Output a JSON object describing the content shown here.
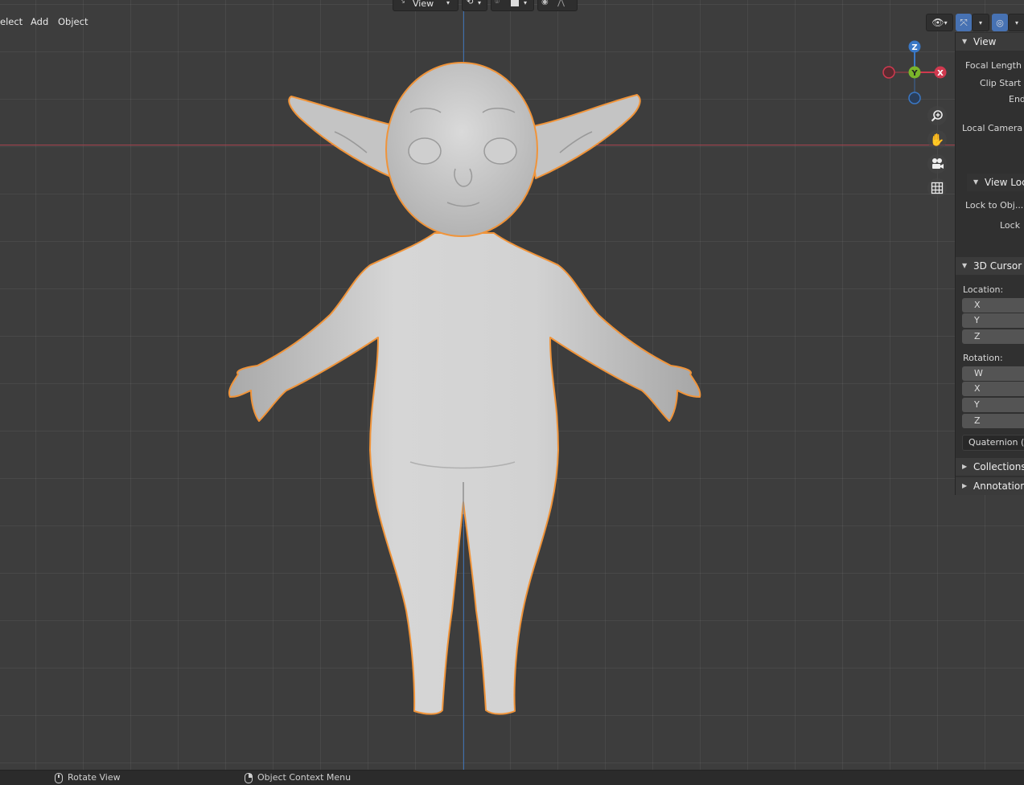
{
  "header": {
    "menu": [
      "elect",
      "Add",
      "Object"
    ],
    "view_dropdown": "View"
  },
  "gizmo": {
    "z": "Z",
    "y": "Y",
    "x": "X"
  },
  "npanel": {
    "view": {
      "title": "View",
      "focal_length": "Focal Length",
      "clip_start": "Clip Start",
      "end": "End",
      "local_camera": "Local Camera"
    },
    "view_lock": {
      "title": "View Lock",
      "lock_to_object": "Lock to Obj...",
      "lock": "Lock"
    },
    "cursor": {
      "title": "3D Cursor",
      "location_label": "Location:",
      "location_axes": [
        "X",
        "Y",
        "Z"
      ],
      "rotation_label": "Rotation:",
      "rotation_axes": [
        "W",
        "X",
        "Y",
        "Z"
      ],
      "rotation_mode": "Quaternion (W"
    },
    "collections": "Collections",
    "annotations": "Annotations"
  },
  "statusbar": {
    "left": "Rotate View",
    "right": "Object Context Menu"
  },
  "colors": {
    "viewport_bg": "#3d3d3d",
    "x_axis": "#a8444f",
    "z_axis": "#3c6eb0",
    "selection_outline": "#f0943a",
    "gizmo_x": "#d0394f",
    "gizmo_y": "#7ab52a",
    "gizmo_z": "#3a78c6",
    "accent": "#4772b3"
  }
}
